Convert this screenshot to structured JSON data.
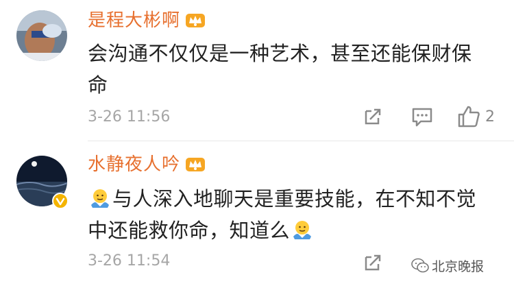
{
  "comments": [
    {
      "username": "是程大彬啊",
      "text_lines": [
        "会沟通不仅仅是一种艺术，甚至还能保财保",
        "命"
      ],
      "time": "3-26 11:56",
      "like_count": "2"
    },
    {
      "username": "水静夜人吟",
      "text_parts": {
        "line1": "与人深入地聊天是重要技能，在不知不觉",
        "line2": "中还能救你命，知道么"
      },
      "time": "3-26 11:54",
      "like_count": ""
    }
  ],
  "icons": {
    "badge": "crown-icon",
    "share": "share-icon",
    "comment": "comment-icon",
    "like": "thumbs-up-icon",
    "emoji": "shrug-emoji-icon"
  },
  "colors": {
    "username": "#e7702f",
    "text": "#222222",
    "meta": "#a6a6a6",
    "verified": "#f4b400"
  },
  "watermark": "北京晚报"
}
